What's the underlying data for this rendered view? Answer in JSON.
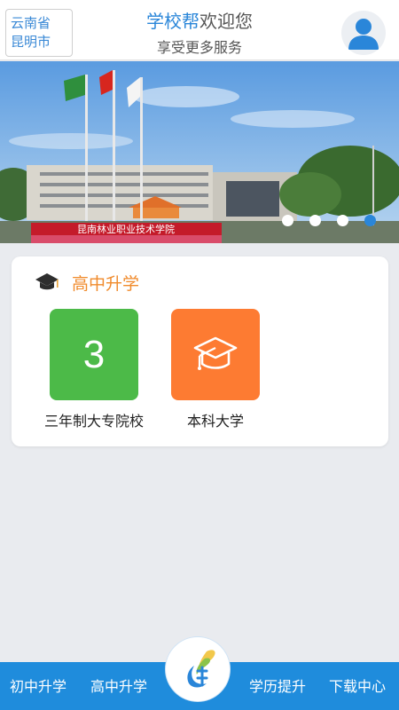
{
  "header": {
    "location_line1": "云南省",
    "location_line2": "昆明市",
    "brand": "学校帮",
    "welcome": "欢迎您",
    "subtitle": "享受更多服务",
    "avatar_icon": "user-avatar-icon"
  },
  "banner": {
    "slides": 4,
    "active_slide": 4,
    "sign_text": "昆南林业职业技术学院"
  },
  "card": {
    "title": "高中升学",
    "title_icon": "graduation-cap-icon",
    "tiles": [
      {
        "label": "三年制大专院校",
        "number": "3",
        "color": "#4cba48"
      },
      {
        "label": "本科大学",
        "icon": "graduation-cap-icon",
        "color": "#fd7b32"
      }
    ]
  },
  "bottom_nav": {
    "items": [
      "初中升学",
      "高中升学",
      "学历提升",
      "下载中心"
    ],
    "center_icon": "app-logo-icon",
    "color": "#1f8cdc"
  },
  "colors": {
    "brand_blue": "#2a86d9",
    "accent_orange": "#f08a2b"
  }
}
